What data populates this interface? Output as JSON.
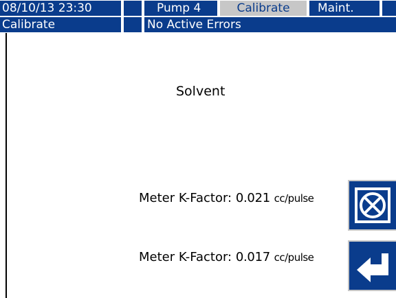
{
  "header": {
    "datetime": "08/10/13 23:30",
    "tabs": [
      {
        "label": "Pump 4",
        "active": false
      },
      {
        "label": "Calibrate",
        "active": true
      },
      {
        "label": "Maint.",
        "active": false
      }
    ],
    "mode": "Calibrate",
    "errors": "No Active Errors"
  },
  "main": {
    "title": "Solvent",
    "meters": [
      {
        "label": "Meter K-Factor:",
        "value": "0.021",
        "unit": "cc/pulse",
        "action_icon": "cancel-icon"
      },
      {
        "label": "Meter K-Factor:",
        "value": "0.017",
        "unit": "cc/pulse",
        "action_icon": "enter-icon"
      }
    ]
  },
  "colors": {
    "accent": "#0a3c8c",
    "tab_active": "#c7c7c7",
    "background": "#ffffff"
  }
}
